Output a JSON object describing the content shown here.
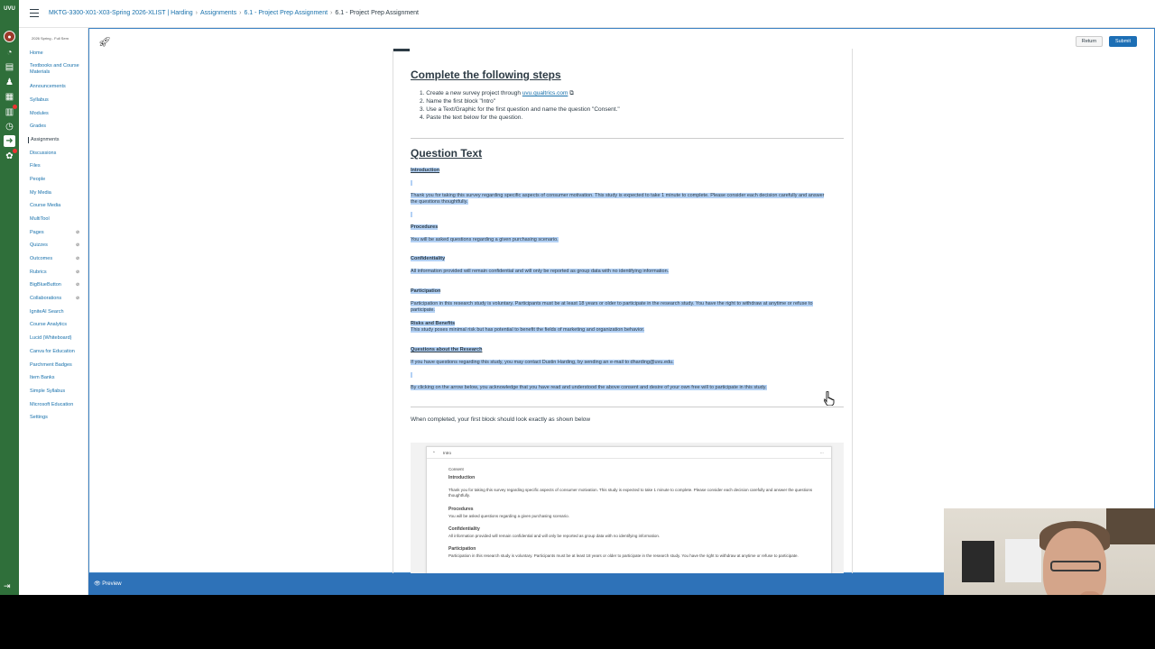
{
  "breadcrumb": {
    "course": "MKTG-3300-X01-X03-Spring 2026-XLIST | Harding",
    "section": "Assignments",
    "parent": "6.1 - Project Prep Assignment",
    "current": "6.1 - Project Prep Assignment"
  },
  "global_nav": {
    "logo": "UVU",
    "icons": [
      "account-icon",
      "dashboard-icon",
      "courses-icon",
      "groups-icon",
      "calendar-icon",
      "inbox-icon",
      "history-icon",
      "studio-icon",
      "help-icon"
    ]
  },
  "course_nav": {
    "term": "2026 Spring - Full Sem",
    "items": [
      {
        "label": "Home"
      },
      {
        "label": "Textbooks and Course Materials"
      },
      {
        "label": "Announcements"
      },
      {
        "label": "Syllabus"
      },
      {
        "label": "Modules"
      },
      {
        "label": "Grades"
      },
      {
        "label": "Assignments"
      },
      {
        "label": "Discussions"
      },
      {
        "label": "Files"
      },
      {
        "label": "People"
      },
      {
        "label": "My Media"
      },
      {
        "label": "Course Media"
      },
      {
        "label": "MultiTool"
      },
      {
        "label": "Pages"
      },
      {
        "label": "Quizzes"
      },
      {
        "label": "Outcomes"
      },
      {
        "label": "Rubrics"
      },
      {
        "label": "BigBlueButton"
      },
      {
        "label": "Collaborations"
      },
      {
        "label": "IgniteAI Search"
      },
      {
        "label": "Course Analytics"
      },
      {
        "label": "Lucid (Whiteboard)"
      },
      {
        "label": "Canva for Education"
      },
      {
        "label": "Parchment Badges"
      },
      {
        "label": "Item Banks"
      },
      {
        "label": "Simple Syllabus"
      },
      {
        "label": "Microsoft Education"
      },
      {
        "label": "Settings"
      }
    ],
    "active": "Assignments"
  },
  "toolbar": {
    "return_label": "Return",
    "submit_label": "Submit"
  },
  "content": {
    "steps_heading": "Complete the following steps",
    "steps": [
      {
        "prefix": "1. Create a new survey project through ",
        "link": "uvu.qualtrics.com"
      },
      {
        "text": "2. Name the first block \"Intro\""
      },
      {
        "text": "3. Use a Text/Graphic for the first question and name the question \"Consent.\""
      },
      {
        "text": "4. Paste the text below for the question."
      }
    ],
    "question_heading": "Question Text",
    "intro_label": "Introduction",
    "intro_text": "Thank you for taking this survey regarding specific aspects of consumer motivation. This study is expected to take 1 minute to complete. Please consider each decision carefully and answer the questions thoughtfully.",
    "procedures_label": "Procedures",
    "procedures_text": "You will be asked questions regarding a given purchasing scenario.",
    "confidentiality_label": "Confidentiality",
    "confidentiality_text": "All information provided will remain confidential and will only be reported as group data with no identifying information.",
    "participation_label": "Participation",
    "participation_text": "Participation in this research study is voluntary. Participants must be at least 18 years or older to participate in the research study. You have the right to withdraw at anytime or refuse to participate.",
    "risks_label": "Risks and Benefits",
    "risks_text": "This study poses minimal risk but has potential to benefit the fields of marketing and organization behavior.",
    "questions_label": "Questions about the Research",
    "questions_text": "If you have questions regarding this study, you may contact Dustin Harding, by sending an e-mail to dharding@uvu.edu.",
    "closing_text": "By clicking on the arrow below, you acknowledge that you have read and understood the above consent and desire of your own free will to participate in this study.",
    "completed_note": "When completed, your first block should look exactly as shown below"
  },
  "preview_card": {
    "block_name": "Intro",
    "question_name": "Consent",
    "menu": "...",
    "intro_label": "Introduction",
    "intro_text": "Thank you for taking this survey regarding specific aspects of consumer motivation. This study is expected to take 1 minute to complete. Please consider each decision carefully and answer the questions thoughtfully.",
    "procedures_label": "Procedures",
    "procedures_text": "You will be asked questions regarding a given purchasing scenario.",
    "confidentiality_label": "Confidentiality",
    "confidentiality_text": "All information provided will remain confidential and will only be reported as group data with no identifying information.",
    "participation_label": "Participation",
    "participation_text": "Participation in this research study is voluntary. Participants must be at least 18 years or older to participate in the research study. You have the right to withdraw at anytime or refuse to participate."
  },
  "footer": {
    "preview_label": "Preview"
  },
  "colors": {
    "global_nav": "#2f6f3a",
    "link": "#1770ab",
    "selection": "#b3d1f5",
    "footer": "#2e72b8",
    "submit": "#1d6fb5"
  }
}
